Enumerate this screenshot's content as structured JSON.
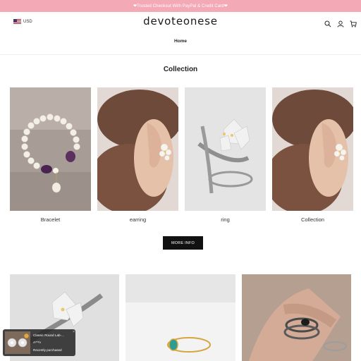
{
  "announcement": "❤Trusted Checkout With PayPal & Credit Card❤",
  "header": {
    "currency": "USD",
    "logo": "devoteonese",
    "icons": [
      "search-icon",
      "account-icon",
      "cart-icon"
    ]
  },
  "nav": {
    "home": "Home"
  },
  "collection_section": {
    "title": "Collection",
    "items": [
      {
        "label": "Bracelet"
      },
      {
        "label": "earring"
      },
      {
        "label": "ring"
      },
      {
        "label": "Collection"
      }
    ],
    "more_button": "MORE INFO"
  },
  "popup": {
    "product": "Classic Round Lab-...",
    "buyer": "A***n",
    "status": "Recently purchased"
  },
  "colors": {
    "announcement_bg": "#f4a9b6",
    "button_bg": "#111111"
  }
}
